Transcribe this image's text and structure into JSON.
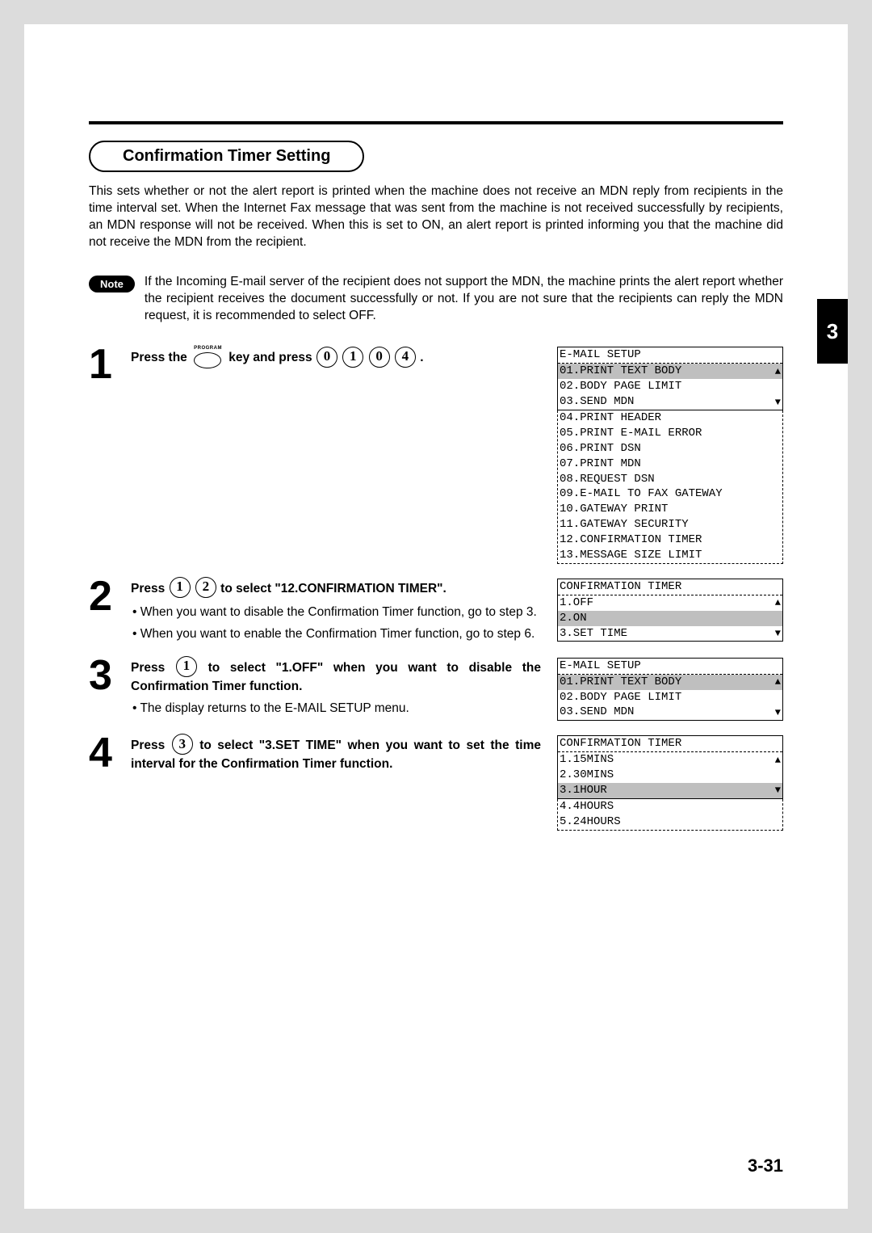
{
  "chapter_tab": "3",
  "page_number": "3-31",
  "section_title": "Confirmation Timer Setting",
  "intro": "This sets whether or not the alert report is printed when the machine does not receive an MDN reply from recipients in the time interval set.  When the Internet Fax message that was sent from the machine is not received successfully by recipients, an MDN response will not be received. When this is set to ON, an alert report is printed informing you that the machine did not receive the MDN from the recipient.",
  "note_label": "Note",
  "note_text": "If the Incoming E-mail server of the recipient does not support the MDN, the machine prints the alert report whether the recipient receives the document successfully or not.  If you are not sure that the recipients can reply the MDN request, it is recommended to select OFF.",
  "program_label": "PROGRAM",
  "steps": {
    "s1": {
      "num": "1",
      "text_a": "Press the",
      "text_b": "key and press",
      "keys": [
        "0",
        "1",
        "0",
        "4"
      ],
      "dot": "."
    },
    "s2": {
      "num": "2",
      "text_a": "Press",
      "keys": [
        "1",
        "2"
      ],
      "text_b": "to select \"12.CONFIRMATION TIMER\".",
      "bullets": [
        "• When you want to disable the Confirmation Timer function, go to step 3.",
        "• When you want to enable the Confirmation Timer function, go to step 6."
      ]
    },
    "s3": {
      "num": "3",
      "text_a": "Press",
      "keys": [
        "1"
      ],
      "text_b": "to select \"1.OFF\" when you want to disable the Confirmation Timer function.",
      "bullets": [
        "• The display returns to the E-MAIL SETUP menu."
      ]
    },
    "s4": {
      "num": "4",
      "text_a": "Press",
      "keys": [
        "3"
      ],
      "text_b": "to select \"3.SET TIME\" when you want to set the time interval for the Confirmation Timer function."
    }
  },
  "screens": {
    "sc1": {
      "title": "E-MAIL SETUP",
      "visible": [
        {
          "t": "01.PRINT TEXT BODY",
          "hl": true,
          "arrow": "up"
        },
        {
          "t": "02.BODY PAGE LIMIT"
        },
        {
          "t": "03.SEND MDN",
          "arrow": "down"
        }
      ],
      "hidden": [
        "04.PRINT HEADER",
        "05.PRINT E-MAIL ERROR",
        "06.PRINT DSN",
        "07.PRINT MDN",
        "08.REQUEST DSN",
        "09.E-MAIL TO FAX GATEWAY",
        "10.GATEWAY PRINT",
        "11.GATEWAY SECURITY",
        "12.CONFIRMATION TIMER",
        "13.MESSAGE SIZE LIMIT"
      ]
    },
    "sc2": {
      "title": "CONFIRMATION TIMER",
      "visible": [
        {
          "t": "1.OFF",
          "arrow": "up"
        },
        {
          "t": "2.ON",
          "hl": true
        },
        {
          "t": "3.SET TIME",
          "arrow": "down"
        }
      ]
    },
    "sc3": {
      "title": "E-MAIL SETUP",
      "visible": [
        {
          "t": "01.PRINT TEXT BODY",
          "hl": true,
          "arrow": "up"
        },
        {
          "t": "02.BODY PAGE LIMIT"
        },
        {
          "t": "03.SEND MDN",
          "arrow": "down"
        }
      ]
    },
    "sc4": {
      "title": "CONFIRMATION TIMER",
      "visible": [
        {
          "t": "1.15MINS",
          "arrow": "up"
        },
        {
          "t": "2.30MINS"
        },
        {
          "t": "3.1HOUR",
          "hl": true,
          "arrow": "down"
        }
      ],
      "hidden": [
        "4.4HOURS",
        "5.24HOURS"
      ]
    }
  }
}
